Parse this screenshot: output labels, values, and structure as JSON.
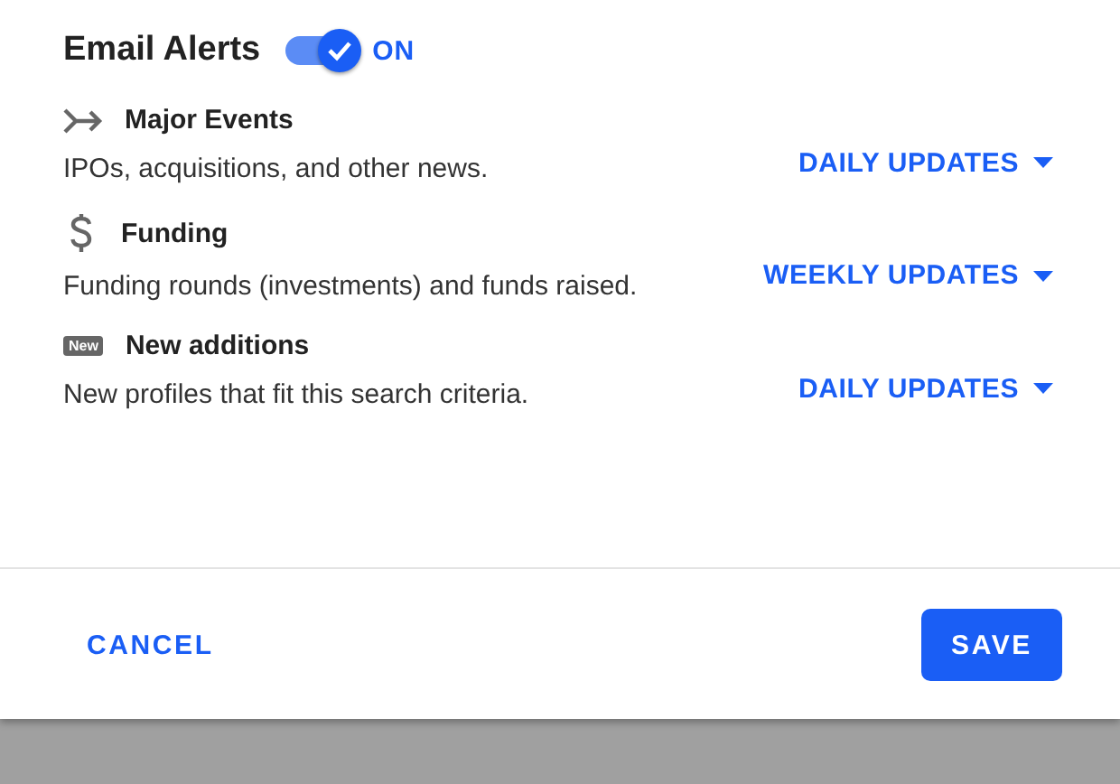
{
  "header": {
    "title": "Email Alerts",
    "toggle": {
      "on": true,
      "label": "ON"
    }
  },
  "alerts": [
    {
      "kind": "merge",
      "title": "Major Events",
      "description": "IPOs, acquisitions, and other news.",
      "frequency": "DAILY UPDATES"
    },
    {
      "kind": "dollar",
      "title": "Funding",
      "description": "Funding rounds (investments) and funds raised.",
      "frequency": "WEEKLY UPDATES"
    },
    {
      "kind": "badge",
      "badge": "New",
      "title": "New additions",
      "description": "New profiles that fit this search criteria.",
      "frequency": "DAILY UPDATES"
    }
  ],
  "buttons": {
    "cancel": "CANCEL",
    "save": "SAVE"
  }
}
